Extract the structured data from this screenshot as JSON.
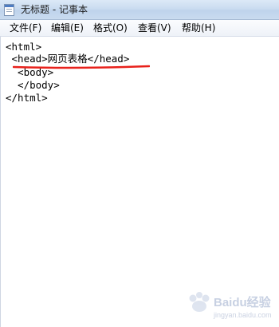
{
  "window": {
    "title": "无标题 - 记事本"
  },
  "menu": [
    {
      "label": "文件(F)"
    },
    {
      "label": "编辑(E)"
    },
    {
      "label": "格式(O)"
    },
    {
      "label": "查看(V)"
    },
    {
      "label": "帮助(H)"
    }
  ],
  "editor": {
    "lines": [
      "<html>",
      " <head>网页表格</head>",
      "  <body>",
      "  </body>",
      "</html>"
    ]
  },
  "annotation": {
    "color": "#e8211b"
  },
  "watermark": {
    "text": "Baidu经验",
    "site": "jingyan.baidu.com"
  }
}
